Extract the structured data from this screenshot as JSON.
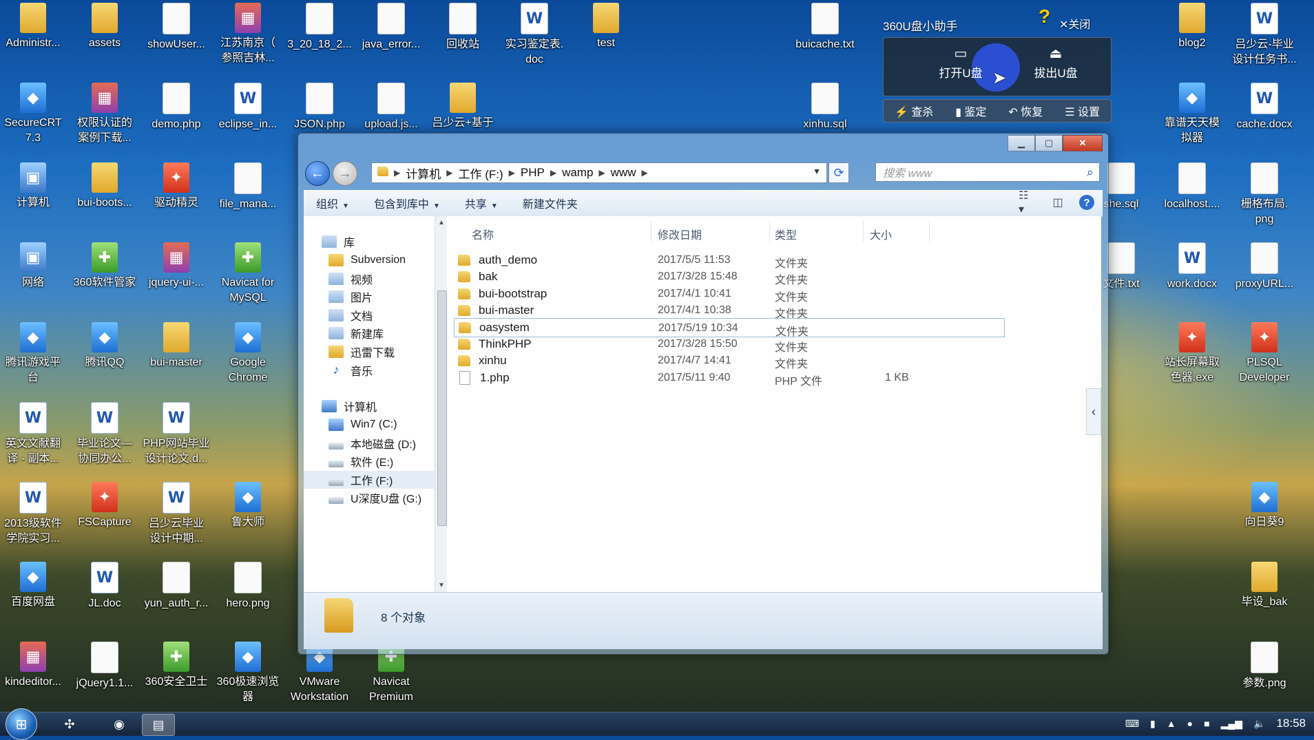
{
  "desktop": {
    "icons": [
      {
        "label": "Administr...",
        "icon": "user-folder-icon",
        "kind": "folder"
      },
      {
        "label": "assets",
        "icon": "folder-icon",
        "kind": "folder"
      },
      {
        "label": "showUser...",
        "icon": "file-icon",
        "kind": "file"
      },
      {
        "label": "江苏南京（\n参照吉林...",
        "icon": "archive-icon",
        "kind": "pack"
      },
      {
        "label": "3_20_18_2...",
        "icon": "file-icon",
        "kind": "file"
      },
      {
        "label": "java_error...",
        "icon": "file-icon",
        "kind": "file"
      },
      {
        "label": "回收站",
        "icon": "recycle-bin-icon",
        "kind": "file"
      },
      {
        "label": "实习鉴定表.\ndoc",
        "icon": "word-doc-icon",
        "kind": "word"
      },
      {
        "label": "test",
        "icon": "folder-icon",
        "kind": "folder"
      },
      {
        "label": "buicache.txt",
        "icon": "text-file-icon",
        "kind": "file"
      },
      {
        "label": "blog2",
        "icon": "folder-icon",
        "kind": "folder"
      },
      {
        "label": "吕少云-毕业\n设计任务书...",
        "icon": "word-doc-icon",
        "kind": "word"
      },
      {
        "label": "SecureCRT\n7.3",
        "icon": "securecrt-icon",
        "kind": "app"
      },
      {
        "label": "权限认证的\n案例下载...",
        "icon": "archive-icon",
        "kind": "pack"
      },
      {
        "label": "demo.php",
        "icon": "file-icon",
        "kind": "file"
      },
      {
        "label": "eclipse_in...",
        "icon": "word-doc-icon",
        "kind": "word"
      },
      {
        "label": "JSON.php",
        "icon": "file-icon",
        "kind": "file"
      },
      {
        "label": "upload.js...",
        "icon": "file-icon",
        "kind": "file"
      },
      {
        "label": "吕少云+基于",
        "icon": "folder-icon",
        "kind": "folder"
      },
      {
        "label": "xinhu.sql",
        "icon": "file-icon",
        "kind": "file"
      },
      {
        "label": "靠谱天天模\n拟器",
        "icon": "emulator-icon",
        "kind": "app"
      },
      {
        "label": "cache.docx",
        "icon": "word-doc-icon",
        "kind": "word"
      },
      {
        "label": "计算机",
        "icon": "computer-icon",
        "kind": "pc"
      },
      {
        "label": "bui-boots...",
        "icon": "folder-icon",
        "kind": "folder"
      },
      {
        "label": "驱动精灵",
        "icon": "driver-genius-icon",
        "kind": "red"
      },
      {
        "label": "file_mana...",
        "icon": "file-icon",
        "kind": "file"
      },
      {
        "label": "she.sql",
        "icon": "file-icon",
        "kind": "file"
      },
      {
        "label": "localhost....",
        "icon": "file-icon",
        "kind": "file"
      },
      {
        "label": "栅格布局.\npng",
        "icon": "image-file-icon",
        "kind": "file"
      },
      {
        "label": "网络",
        "icon": "network-icon",
        "kind": "pc"
      },
      {
        "label": "360软件管家",
        "icon": "360-manager-icon",
        "kind": "green"
      },
      {
        "label": "jquery-ui-...",
        "icon": "archive-icon",
        "kind": "pack"
      },
      {
        "label": "Navicat for\nMySQL",
        "icon": "navicat-icon",
        "kind": "green"
      },
      {
        "label": "文件.txt",
        "icon": "text-file-icon",
        "kind": "file"
      },
      {
        "label": "work.docx",
        "icon": "word-doc-icon",
        "kind": "word"
      },
      {
        "label": "proxyURL...",
        "icon": "file-icon",
        "kind": "file"
      },
      {
        "label": "腾讯游戏平\n台",
        "icon": "tencent-games-icon",
        "kind": "app"
      },
      {
        "label": "腾讯QQ",
        "icon": "qq-icon",
        "kind": "app"
      },
      {
        "label": "bui-master",
        "icon": "folder-icon",
        "kind": "folder"
      },
      {
        "label": "Google\nChrome",
        "icon": "chrome-icon",
        "kind": "app"
      },
      {
        "label": "站长屏幕取\n色器.exe",
        "icon": "color-picker-icon",
        "kind": "red"
      },
      {
        "label": "PLSQL\nDeveloper",
        "icon": "plsql-icon",
        "kind": "red"
      },
      {
        "label": "英文文献翻\n译 - 副本...",
        "icon": "word-doc-icon",
        "kind": "word"
      },
      {
        "label": "毕业论文—\n协同办公...",
        "icon": "word-doc-icon",
        "kind": "word"
      },
      {
        "label": "PHP网站毕业\n设计论文.d...",
        "icon": "word-doc-icon",
        "kind": "word"
      },
      {
        "label": "2013级软件\n学院实习...",
        "icon": "word-doc-icon",
        "kind": "word"
      },
      {
        "label": "FSCapture",
        "icon": "fscapture-icon",
        "kind": "red"
      },
      {
        "label": "吕少云毕业\n设计中期...",
        "icon": "word-doc-icon",
        "kind": "word"
      },
      {
        "label": "鲁大师",
        "icon": "ludashi-icon",
        "kind": "app"
      },
      {
        "label": "向日葵9",
        "icon": "sunflower-icon",
        "kind": "app"
      },
      {
        "label": "百度网盘",
        "icon": "baidu-netdisk-icon",
        "kind": "app"
      },
      {
        "label": "JL.doc",
        "icon": "word-doc-icon",
        "kind": "word"
      },
      {
        "label": "yun_auth_r...",
        "icon": "file-icon",
        "kind": "file"
      },
      {
        "label": "hero.png",
        "icon": "image-file-icon",
        "kind": "file"
      },
      {
        "label": "毕设_bak",
        "icon": "folder-icon",
        "kind": "folder"
      },
      {
        "label": "kindeditor...",
        "icon": "archive-icon",
        "kind": "pack"
      },
      {
        "label": "jQuery1.1...",
        "icon": "file-icon",
        "kind": "file"
      },
      {
        "label": "360安全卫士",
        "icon": "360-safe-icon",
        "kind": "green"
      },
      {
        "label": "360极速浏览\n器",
        "icon": "360-browser-icon",
        "kind": "app"
      },
      {
        "label": "VMware\nWorkstation",
        "icon": "vmware-icon",
        "kind": "app"
      },
      {
        "label": "Navicat\nPremium",
        "icon": "navicat-icon",
        "kind": "green"
      },
      {
        "label": "参数.png",
        "icon": "image-file-icon",
        "kind": "file"
      }
    ]
  },
  "usb_popup": {
    "title": "360U盘小助手",
    "close_label": "关闭",
    "open_label": "打开U盘",
    "eject_label": "拔出U盘",
    "toolbar": [
      "查杀",
      "鉴定",
      "恢复",
      "设置"
    ]
  },
  "explorer": {
    "address": [
      "计算机",
      "工作 (F:)",
      "PHP",
      "wamp",
      "www"
    ],
    "search_placeholder": "搜索 www",
    "commands": [
      "组织",
      "包含到库中",
      "共享",
      "新建文件夹"
    ],
    "columns": {
      "name": "名称",
      "date": "修改日期",
      "type": "类型",
      "size": "大小"
    },
    "nav": {
      "libraries": "库",
      "library_items": [
        "Subversion",
        "视频",
        "图片",
        "文档",
        "新建库",
        "迅雷下载",
        "音乐"
      ],
      "computer": "计算机",
      "drives": [
        "Win7 (C:)",
        "本地磁盘 (D:)",
        "软件 (E:)",
        "工作 (F:)",
        "U深度U盘 (G:)"
      ]
    },
    "files": [
      {
        "name": "auth_demo",
        "date": "2017/5/5 11:53",
        "type": "文件夹",
        "size": ""
      },
      {
        "name": "bak",
        "date": "2017/3/28 15:48",
        "type": "文件夹",
        "size": ""
      },
      {
        "name": "bui-bootstrap",
        "date": "2017/4/1 10:41",
        "type": "文件夹",
        "size": ""
      },
      {
        "name": "bui-master",
        "date": "2017/4/1 10:38",
        "type": "文件夹",
        "size": ""
      },
      {
        "name": "oasystem",
        "date": "2017/5/19 10:34",
        "type": "文件夹",
        "size": ""
      },
      {
        "name": "ThinkPHP",
        "date": "2017/3/28 15:50",
        "type": "文件夹",
        "size": ""
      },
      {
        "name": "xinhu",
        "date": "2017/4/7 14:41",
        "type": "文件夹",
        "size": ""
      },
      {
        "name": "1.php",
        "date": "2017/5/11 9:40",
        "type": "PHP 文件",
        "size": "1 KB"
      }
    ],
    "status": "8 个对象"
  },
  "taskbar": {
    "clock": "18:58"
  }
}
